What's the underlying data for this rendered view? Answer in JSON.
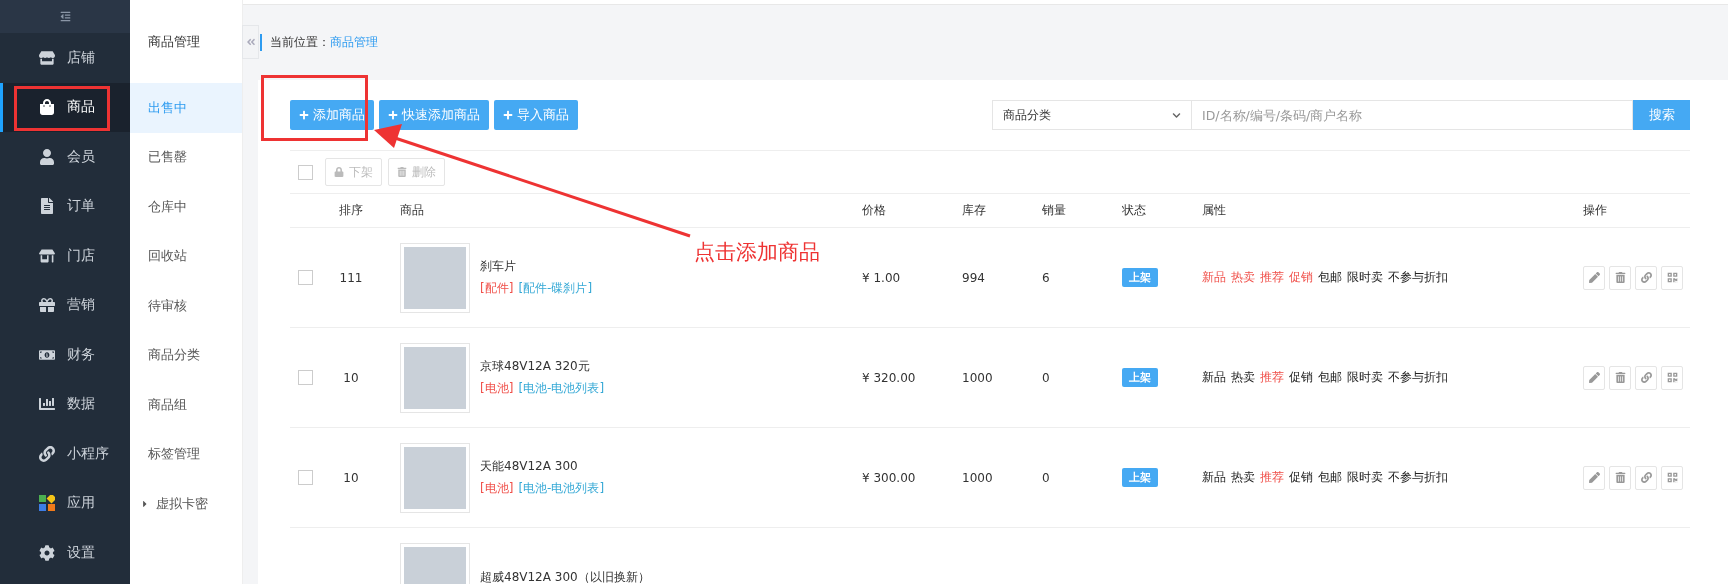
{
  "sidebar": {
    "items": [
      {
        "label": "店铺",
        "selected": false
      },
      {
        "label": "商品",
        "selected": true
      },
      {
        "label": "会员",
        "selected": false
      },
      {
        "label": "订单",
        "selected": false
      },
      {
        "label": "门店",
        "selected": false
      },
      {
        "label": "营销",
        "selected": false
      },
      {
        "label": "财务",
        "selected": false
      },
      {
        "label": "数据",
        "selected": false
      },
      {
        "label": "小程序",
        "selected": false
      },
      {
        "label": "应用",
        "selected": false
      },
      {
        "label": "设置",
        "selected": false
      }
    ]
  },
  "subnav": {
    "title": "商品管理",
    "items": [
      {
        "label": "出售中",
        "selected": true
      },
      {
        "label": "已售罄",
        "selected": false
      },
      {
        "label": "仓库中",
        "selected": false
      },
      {
        "label": "回收站",
        "selected": false
      },
      {
        "label": "待审核",
        "selected": false
      },
      {
        "label": "商品分类",
        "selected": false
      },
      {
        "label": "商品组",
        "selected": false
      },
      {
        "label": "标签管理",
        "selected": false
      },
      {
        "label": "虚拟卡密",
        "selected": false,
        "expanded": false
      }
    ]
  },
  "breadcrumb": {
    "label": "当前位置：",
    "current": "商品管理"
  },
  "toolbar": {
    "buttons": [
      "添加商品",
      "快速添加商品",
      "导入商品"
    ],
    "category_select": "商品分类",
    "search": {
      "placeholder": "ID/名称/编号/条码/商户名称"
    },
    "search_button": "搜索"
  },
  "bulk_actions": {
    "checked": false,
    "buttons": [
      {
        "label": "下架",
        "disabled": true
      },
      {
        "label": "删除",
        "disabled": true
      }
    ]
  },
  "table": {
    "columns": [
      "排序",
      "商品",
      "价格",
      "库存",
      "销量",
      "状态",
      "属性",
      "操作"
    ],
    "rows": [
      {
        "checked": false,
        "sort": "111",
        "name": "刹车片",
        "category": "[配件]",
        "subcategory": "[配件-碟刹片]",
        "price": "¥ 1.00",
        "stock": "994",
        "sales": "6",
        "status": "上架",
        "attributes": [
          {
            "text": "新品",
            "highlighted": true
          },
          {
            "text": "热卖",
            "highlighted": true
          },
          {
            "text": "推荐",
            "highlighted": true
          },
          {
            "text": "促销",
            "highlighted": true
          },
          {
            "text": "包邮",
            "highlighted": false
          },
          {
            "text": "限时卖",
            "highlighted": false
          },
          {
            "text": "不参与折扣",
            "highlighted": false
          }
        ]
      },
      {
        "checked": false,
        "sort": "10",
        "name": "京球48V12A 320元",
        "category": "[电池]",
        "subcategory": "[电池-电池列表]",
        "price": "¥ 320.00",
        "stock": "1000",
        "sales": "0",
        "status": "上架",
        "attributes": [
          {
            "text": "新品",
            "highlighted": false
          },
          {
            "text": "热卖",
            "highlighted": false
          },
          {
            "text": "推荐",
            "highlighted": true
          },
          {
            "text": "促销",
            "highlighted": false
          },
          {
            "text": "包邮",
            "highlighted": false
          },
          {
            "text": "限时卖",
            "highlighted": false
          },
          {
            "text": "不参与折扣",
            "highlighted": false
          }
        ]
      },
      {
        "checked": false,
        "sort": "10",
        "name": "天能48V12A 300",
        "category": "[电池]",
        "subcategory": "[电池-电池列表]",
        "price": "¥ 300.00",
        "stock": "1000",
        "sales": "0",
        "status": "上架",
        "attributes": [
          {
            "text": "新品",
            "highlighted": false
          },
          {
            "text": "热卖",
            "highlighted": false
          },
          {
            "text": "推荐",
            "highlighted": true
          },
          {
            "text": "促销",
            "highlighted": false
          },
          {
            "text": "包邮",
            "highlighted": false
          },
          {
            "text": "限时卖",
            "highlighted": false
          },
          {
            "text": "不参与折扣",
            "highlighted": false
          }
        ]
      },
      {
        "name": "超威48V12A 300（以旧换新）"
      }
    ]
  },
  "annotation": {
    "text": "点击添加商品"
  }
}
